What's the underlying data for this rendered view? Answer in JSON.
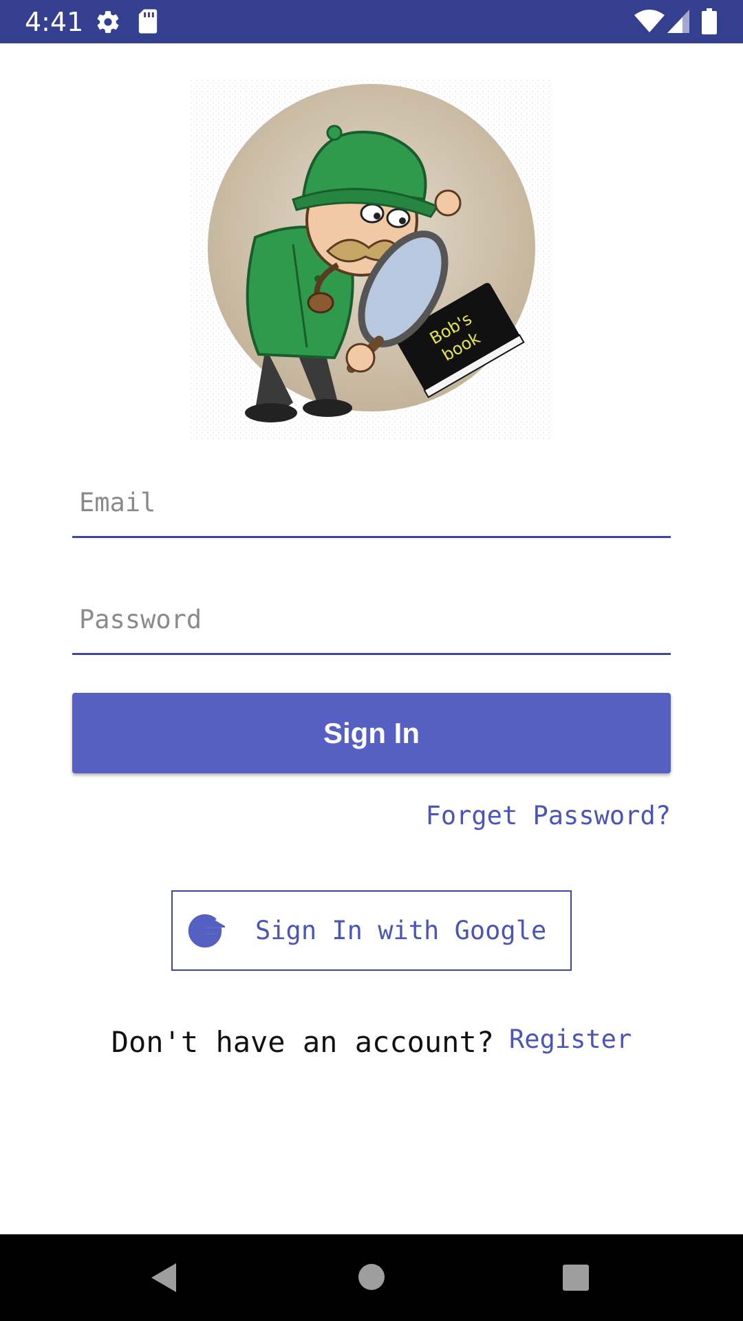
{
  "status_bar": {
    "time": "4:41",
    "icons": [
      "gear-icon",
      "sd-card-icon",
      "wifi-icon",
      "signal-icon",
      "battery-icon"
    ]
  },
  "logo": {
    "book_text": "Bob's book"
  },
  "form": {
    "email_placeholder": "Email",
    "email_value": "",
    "password_placeholder": "Password",
    "password_value": "",
    "sign_in_label": "Sign In",
    "forgot_label": "Forget Password?",
    "google_label": "Sign In with Google",
    "no_account_text": "Don't have an account?",
    "register_label": "Register"
  },
  "colors": {
    "status_bar": "#353f8f",
    "accent": "#5560c2",
    "link": "#4b54ba",
    "nav_bar": "#000000"
  },
  "nav_bar": {
    "icons": [
      "back-icon",
      "home-icon",
      "recents-icon"
    ]
  }
}
